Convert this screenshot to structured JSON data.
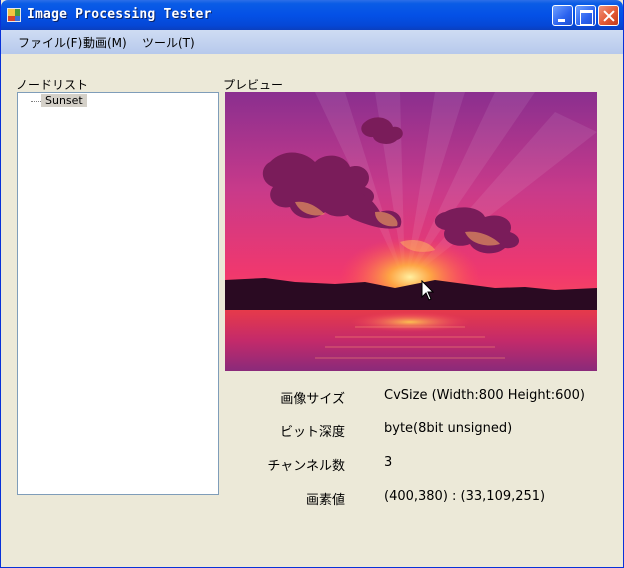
{
  "window": {
    "title": "Image Processing Tester"
  },
  "menu": {
    "items": [
      {
        "label": "ファイル(F)"
      },
      {
        "label": "動画(M)"
      },
      {
        "label": "ツール(T)"
      }
    ]
  },
  "node_list": {
    "label": "ノードリスト",
    "items": [
      {
        "label": "Sunset"
      }
    ]
  },
  "preview": {
    "label": "プレビュー"
  },
  "info": {
    "rows": [
      {
        "label": "画像サイズ",
        "value": "CvSize (Width:800 Height:600)"
      },
      {
        "label": "ビット深度",
        "value": "byte(8bit unsigned)"
      },
      {
        "label": "チャンネル数",
        "value": "3"
      },
      {
        "label": "画素値",
        "value": "(400,380) : (33,109,251)"
      }
    ]
  }
}
